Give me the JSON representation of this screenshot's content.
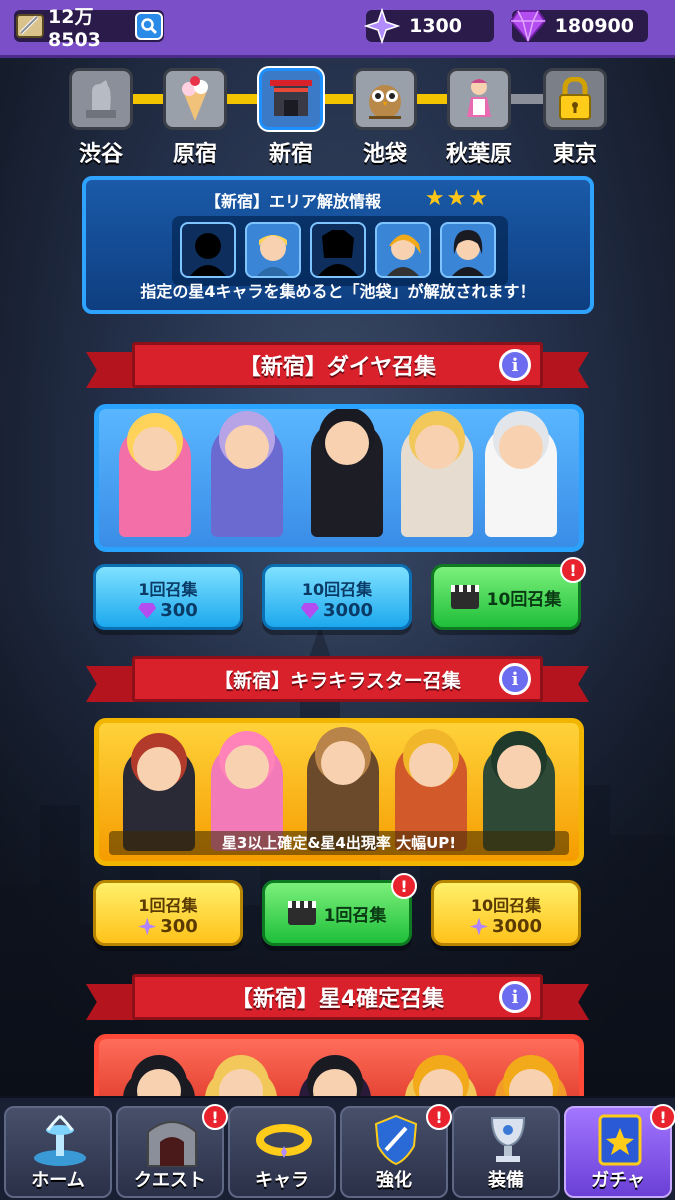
{
  "topbar": {
    "power": "12万8503",
    "sparkles": "1300",
    "gems": "180900"
  },
  "areas": [
    {
      "name": "渋谷",
      "icon": "statue-icon",
      "active": false
    },
    {
      "name": "原宿",
      "icon": "crepe-icon",
      "active": false
    },
    {
      "name": "新宿",
      "icon": "shrine-gate-icon",
      "active": true
    },
    {
      "name": "池袋",
      "icon": "owl-icon",
      "active": false
    },
    {
      "name": "秋葉原",
      "icon": "maid-icon",
      "active": false
    },
    {
      "name": "東京",
      "icon": "lock-icon",
      "active": false
    }
  ],
  "unlock": {
    "title": "【新宿】エリア解放情報",
    "stars": "★★★",
    "message": "指定の星4キャラを集めると「池袋」が解放されます！"
  },
  "sections": [
    {
      "title": "【新宿】ダイヤ召集",
      "buttons": [
        {
          "line1": "1回召集",
          "line2": "300"
        },
        {
          "line1": "10回召集",
          "line2": "3000"
        },
        {
          "line1": "10回召集"
        }
      ]
    },
    {
      "title": "【新宿】キラキラスター召集",
      "caption": "星3以上確定&星4出現率 大幅UP!",
      "buttons": [
        {
          "line1": "1回召集",
          "line2": "300"
        },
        {
          "line1": "1回召集"
        },
        {
          "line1": "10回召集",
          "line2": "3000"
        }
      ]
    },
    {
      "title": "【新宿】星4確定召集"
    }
  ],
  "info_glyph": "i",
  "alert_glyph": "!",
  "nav": [
    {
      "label": "ホーム",
      "icon": "fountain-icon",
      "alert": false
    },
    {
      "label": "クエスト",
      "icon": "gate-icon",
      "alert": true
    },
    {
      "label": "キャラ",
      "icon": "halo-icon",
      "alert": false
    },
    {
      "label": "強化",
      "icon": "shield-sword-icon",
      "alert": true
    },
    {
      "label": "装備",
      "icon": "trophy-icon",
      "alert": false
    },
    {
      "label": "ガチャ",
      "icon": "gacha-book-icon",
      "alert": true,
      "active": true
    }
  ],
  "colors": {
    "topbar": "#7b4fc7",
    "banner_red": "#d8212b",
    "panel_blue": "#2aa3ff",
    "panel_gold": "#f2b600",
    "button_cyan": "#1ca8ee",
    "button_green": "#1fbf3a",
    "button_gold": "#ffc21a",
    "alert_red": "#e8232e"
  }
}
